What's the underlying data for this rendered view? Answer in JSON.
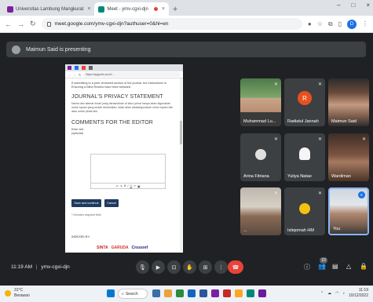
{
  "browser": {
    "tabs": [
      {
        "label": "Universitas Lambung Mangkurat",
        "favicon_color": "#7b1fa2"
      },
      {
        "label": "Meet - ymv-cgxi-djn",
        "favicon_color": "#00897b"
      }
    ],
    "window_controls": [
      "–",
      "□",
      "×"
    ],
    "url": "meet.google.com/ymv-cgxi-djn?authuser=0&hl=en",
    "profile_initial": "D"
  },
  "banner": {
    "text": "Maimun Said is presenting"
  },
  "shared_screen": {
    "url": "https://apjpulm.ac.id/...",
    "note": "If submitting to a peer-reviewed section of the journal, the Instructions in Ensuring a Blind Review have been followed.",
    "privacy_heading": "JOURNAL'S PRIVACY STATEMENT",
    "privacy_text": "Nama dan alamat email yang dimasukkan di situs jurnal hanya akan digunakan untuk tujuan yang sudah disebutkan, tidak akan disalahgunakan untuk tujuan lain atau untuk pihak lain.",
    "comments_heading": "COMMENTS FOR THE EDITOR",
    "editor_label": "Enter text (optional)",
    "save_button": "Save and continue",
    "cancel_button": "Cancel",
    "required_note": "* Denotes required field",
    "indexed_label": "INDEXED BY:",
    "logos": [
      "SINTA",
      "GARUDA",
      "Crossref"
    ]
  },
  "participants": [
    {
      "name": "Muhammad Lu...",
      "type": "photo",
      "muted": true
    },
    {
      "name": "Radiatul Jannah",
      "type": "initial",
      "initial": "R",
      "avatar_color": "#e8501f",
      "muted": true
    },
    {
      "name": "Maimun Said",
      "type": "photo",
      "muted": false
    },
    {
      "name": "Arina Fitriana",
      "type": "avatar",
      "muted": true
    },
    {
      "name": "Yuliya Natae",
      "type": "avatar",
      "muted": true
    },
    {
      "name": "Wardiman",
      "type": "photo",
      "muted": true
    },
    {
      "name": "...",
      "type": "photo",
      "muted": true
    },
    {
      "name": "Istiqomah HM",
      "type": "avatar",
      "muted": true
    },
    {
      "name": "You",
      "type": "photo",
      "muted": false
    }
  ],
  "meeting": {
    "time": "11:19 AM",
    "separator": "|",
    "code": "ymv-cgxi-djn",
    "participant_count": "10"
  },
  "taskbar": {
    "weather_temp": "31°C",
    "weather_desc": "Berawan",
    "search_label": "Search",
    "time": "11:19",
    "date": "10/12/2022"
  },
  "colors": {
    "meet_bg": "#202124",
    "tile_bg": "#3c4043",
    "end_call": "#ea4335",
    "accent": "#1a73e8"
  }
}
